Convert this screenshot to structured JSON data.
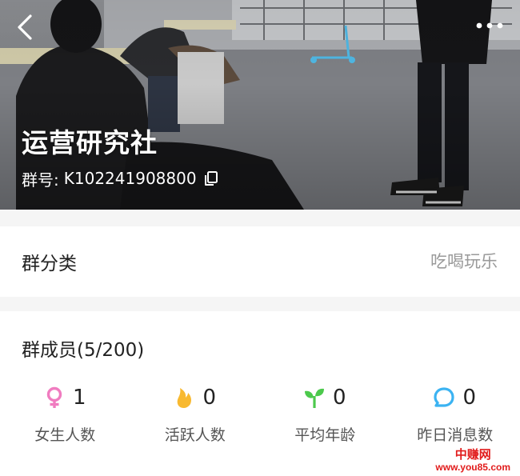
{
  "header": {
    "group_name": "运营研究社",
    "group_id_prefix": "群号:",
    "group_id": "K102241908800"
  },
  "category": {
    "label": "群分类",
    "value": "吃喝玩乐"
  },
  "members": {
    "title": "群成员(5/200)",
    "stats": [
      {
        "icon": "female-icon",
        "color": "#f07cc0",
        "value": "1",
        "label": "女生人数"
      },
      {
        "icon": "flame-icon",
        "color": "#f8b930",
        "value": "0",
        "label": "活跃人数"
      },
      {
        "icon": "sprout-icon",
        "color": "#4cc94c",
        "value": "0",
        "label": "平均年龄"
      },
      {
        "icon": "chat-bubble-icon",
        "color": "#3bb3f2",
        "value": "0",
        "label": "昨日消息数"
      }
    ]
  },
  "watermark": {
    "name": "中赚网",
    "url": "www.you85.com"
  }
}
